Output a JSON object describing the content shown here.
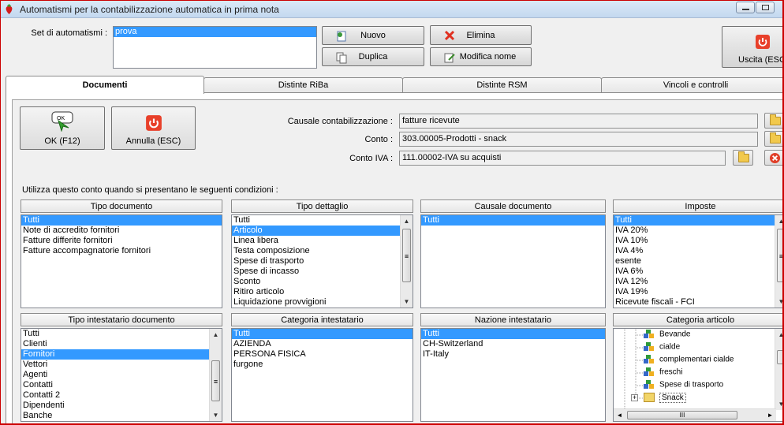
{
  "window": {
    "title": "Automatismi per la contabilizzazione automatica in prima nota"
  },
  "top": {
    "set_label": "Set di automatismi :",
    "set_items": [
      "prova"
    ],
    "buttons": {
      "nuovo": "Nuovo",
      "elimina": "Elimina",
      "duplica": "Duplica",
      "modifica": "Modifica nome",
      "uscita": "Uscita (ESC)"
    }
  },
  "tabs": [
    "Documenti",
    "Distinte RiBa",
    "Distinte RSM",
    "Vincoli e controlli"
  ],
  "doc": {
    "ok_label": "OK (F12)",
    "annulla_label": "Annulla (ESC)",
    "ok_icon_text": "OK",
    "causale_label": "Causale contabilizzazione :",
    "causale_value": "fatture ricevute",
    "conto_label": "Conto :",
    "conto_value": "303.00005-Prodotti - snack",
    "contoiva_label": "Conto IVA :",
    "contoiva_value": "111.00002-IVA su acquisti",
    "conditions_text": "Utilizza questo conto quando si presentano le seguenti condizioni :"
  },
  "panels": {
    "tipo_documento": {
      "title": "Tipo documento",
      "items": [
        "Tutti",
        "Note di accredito fornitori",
        "Fatture differite fornitori",
        "Fatture accompagnatorie fornitori"
      ]
    },
    "tipo_dettaglio": {
      "title": "Tipo dettaglio",
      "items": [
        "Tutti",
        "Articolo",
        "Linea libera",
        "Testa composizione",
        "Spese di trasporto",
        "Spese di incasso",
        "Sconto",
        "Ritiro articolo",
        "Liquidazione provvigioni"
      ]
    },
    "causale_documento": {
      "title": "Causale documento",
      "items": [
        "Tutti"
      ]
    },
    "imposte": {
      "title": "Imposte",
      "items": [
        "Tutti",
        "IVA 20%",
        "IVA 10%",
        "IVA 4%",
        "esente",
        "IVA 6%",
        "IVA  12%",
        "IVA 19%",
        "Ricevute fiscali - FCI"
      ]
    },
    "tipo_intestatario": {
      "title": "Tipo intestatario documento",
      "items": [
        "Tutti",
        "Clienti",
        "Fornitori",
        "Vettori",
        "Agenti",
        "Contatti",
        "Contatti 2",
        "Dipendenti",
        "Banche"
      ]
    },
    "categoria_intestatario": {
      "title": "Categoria intestatario",
      "items": [
        "Tutti",
        "AZIENDA",
        "PERSONA FISICA",
        "furgone"
      ]
    },
    "nazione_intestatario": {
      "title": "Nazione intestatario",
      "items": [
        "Tutti",
        "CH-Switzerland",
        "IT-Italy"
      ]
    },
    "categoria_articolo": {
      "title": "Categoria articolo",
      "items": [
        "Bevande",
        "cialde",
        "complementari cialde",
        "freschi",
        "Spese di trasporto",
        "Snack"
      ],
      "hscroll_text": "III"
    }
  },
  "scroll": {
    "up": "▲",
    "down": "▼",
    "left": "◄",
    "right": "►",
    "grip": "≡"
  },
  "colors": {
    "selection": "#3399ff",
    "frame": "#cc0000"
  }
}
